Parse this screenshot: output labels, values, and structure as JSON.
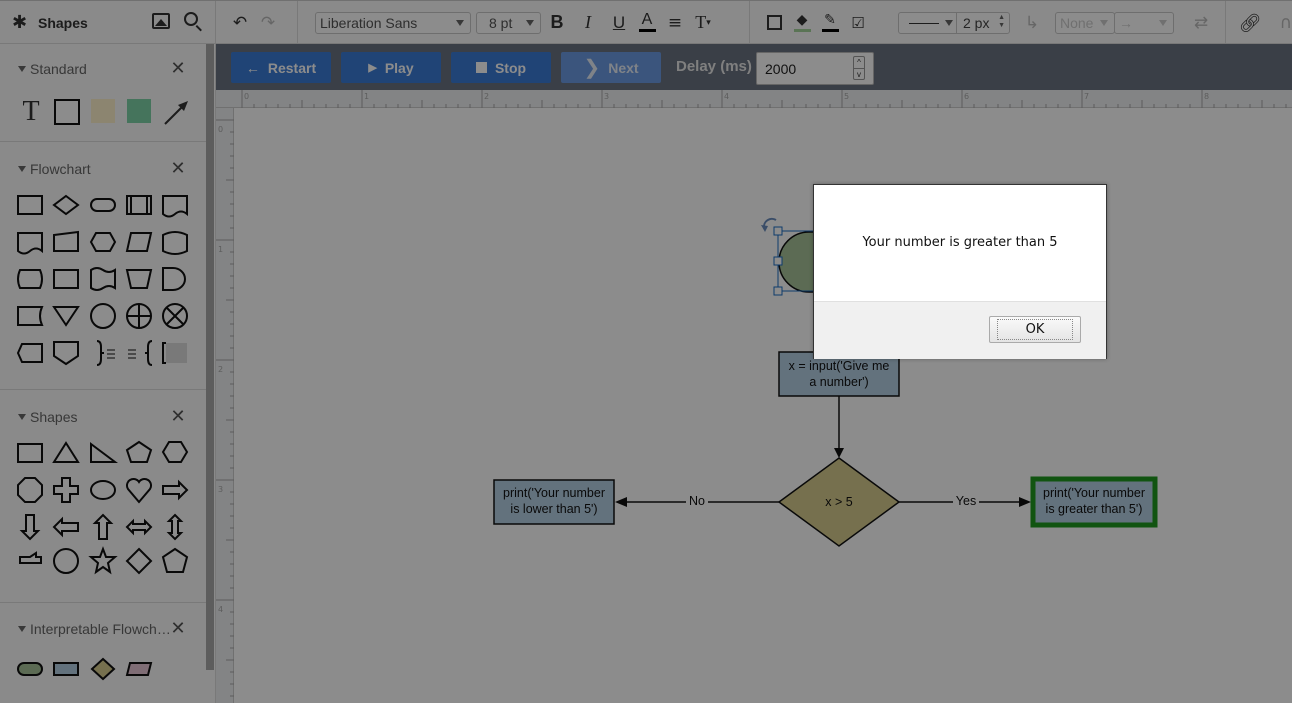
{
  "topbar": {
    "shapes_title": "Shapes",
    "icons": [
      "gear-icon",
      "image-icon",
      "search-icon"
    ],
    "font_family": "Liberation Sans",
    "font_size": "8 pt",
    "line_width": "2 px",
    "waypoint_style": "None",
    "toolbar_icons": [
      "undo-icon",
      "redo-icon",
      "bold-icon",
      "italic-icon",
      "underline-icon",
      "font-color-icon",
      "align-icon",
      "text-options-icon",
      "shape-outline-icon",
      "fill-color-icon",
      "line-color-icon",
      "edit-style-icon",
      "line-style-icon",
      "waypoints-icon",
      "arrow-end-icon",
      "swap-icon",
      "link-icon",
      "magnet-icon"
    ],
    "bold": "B",
    "italic": "I",
    "underline": "U",
    "font_color": "A"
  },
  "controls": {
    "restart": "Restart",
    "play": "Play",
    "stop": "Stop",
    "next": "Next",
    "delay_label": "Delay (ms)",
    "delay_value": "2000"
  },
  "sidebar": {
    "sections": [
      {
        "title": "Standard"
      },
      {
        "title": "Flowchart"
      },
      {
        "title": "Shapes"
      },
      {
        "title": "Interpretable Flowch…"
      }
    ],
    "standard_text_glyph": "T"
  },
  "ruler": {
    "h_labels": [
      "0",
      "1",
      "2",
      "3",
      "4",
      "5",
      "6",
      "7",
      "8"
    ],
    "v_labels": [
      "0",
      "1",
      "2",
      "3",
      "4"
    ]
  },
  "diagram": {
    "input_node": "x = input('Give me a number')",
    "input_line1": "x = input('Give me",
    "input_line2": "a number')",
    "decision": "x > 5",
    "no_label": "No",
    "yes_label": "Yes",
    "left_line1": "print('Your number",
    "left_line2": "is lower than 5')",
    "right_line1": "print('Your number",
    "right_line2": "is greater than 5')",
    "highlight_color": "#1f9a1f",
    "start_color": "#a8c49a",
    "process_color": "#b4cfe3",
    "decision_color": "#d8cd8f"
  },
  "dialog": {
    "message": "Your number is greater than 5",
    "ok": "OK"
  }
}
